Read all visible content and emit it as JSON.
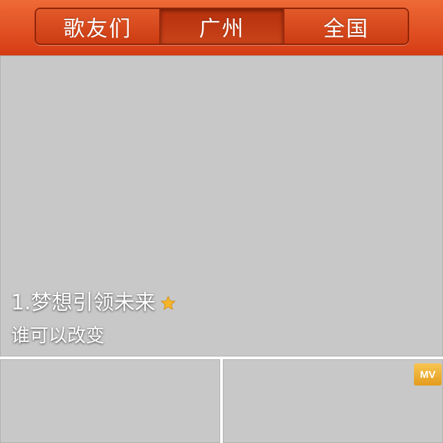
{
  "tabs": [
    {
      "label": "歌友们"
    },
    {
      "label": "广州",
      "active": true
    },
    {
      "label": "全国"
    }
  ],
  "featured": {
    "title": "1.梦想引领未来",
    "subtitle": "谁可以改变",
    "title_icon": "star-icon"
  },
  "tiles": [
    {
      "name": "tile-qingyinyue"
    },
    {
      "name": "tile-mv-video",
      "badge": "MV"
    }
  ],
  "colors": {
    "header": "#d9421a",
    "active_tab": "#b5300c",
    "star": "#f5b528",
    "mv_badge": "#ecab2f"
  }
}
